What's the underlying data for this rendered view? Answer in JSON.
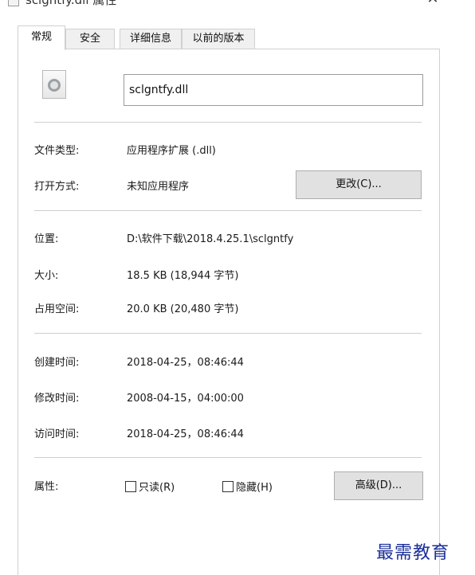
{
  "window": {
    "title": "sclgntfy.dll 属性",
    "close_glyph": "✕"
  },
  "tabs": [
    {
      "label": "常规",
      "active": true
    },
    {
      "label": "安全",
      "active": false
    },
    {
      "label": "详细信息",
      "active": false
    },
    {
      "label": "以前的版本",
      "active": false
    }
  ],
  "general": {
    "file_name": "sclgntfy.dll",
    "file_type_label": "文件类型:",
    "file_type_value": "应用程序扩展 (.dll)",
    "opens_with_label": "打开方式:",
    "opens_with_value": "未知应用程序",
    "change_button": "更改(C)...",
    "location_label": "位置:",
    "location_value": "D:\\软件下载\\2018.4.25.1\\sclgntfy",
    "size_label": "大小:",
    "size_value": "18.5 KB (18,944 字节)",
    "size_on_disk_label": "占用空间:",
    "size_on_disk_value": "20.0 KB (20,480 字节)",
    "created_label": "创建时间:",
    "created_value": "2018-04-25，08:46:44",
    "modified_label": "修改时间:",
    "modified_value": "2008-04-15，04:00:00",
    "accessed_label": "访问时间:",
    "accessed_value": "2018-04-25，08:46:44",
    "attributes_label": "属性:",
    "readonly_label": "只读(R)",
    "readonly_checked": false,
    "hidden_label": "隐藏(H)",
    "hidden_checked": false,
    "advanced_button": "高级(D)..."
  },
  "watermark": "最需教育"
}
